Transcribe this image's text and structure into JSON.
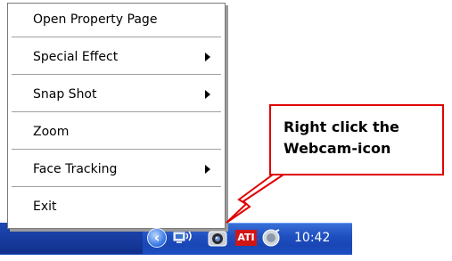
{
  "menu": {
    "items": [
      {
        "label": "Open Property Page",
        "submenu": false
      },
      {
        "label": "Special Effect",
        "submenu": true
      },
      {
        "label": "Snap Shot",
        "submenu": true
      },
      {
        "label": "Zoom",
        "submenu": false
      },
      {
        "label": "Face Tracking",
        "submenu": true
      },
      {
        "label": "Exit",
        "submenu": false
      }
    ]
  },
  "callout": {
    "text": "Right click the\nWebcam-icon",
    "color": "#e00000"
  },
  "tray": {
    "icons": [
      "show-hidden-icons-chevron-icon",
      "network-icon",
      "webcam-icon",
      "ati-icon",
      "volume-icon"
    ],
    "ati_label": "ATI",
    "chevron_glyph": "‹",
    "clock": "10:42",
    "taskbar_color": "#1f4fc0"
  }
}
